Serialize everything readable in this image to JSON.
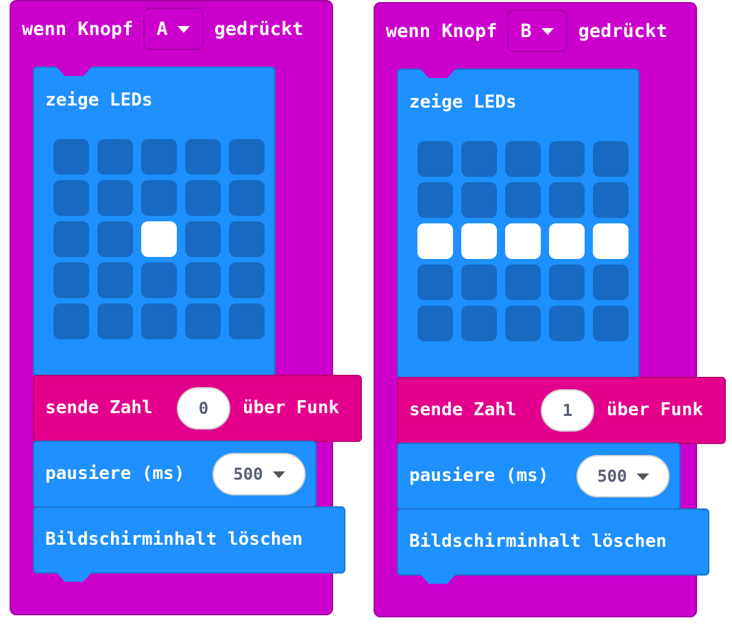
{
  "workspace": {
    "events": [
      {
        "event_prefix": "wenn Knopf",
        "button_value": "A",
        "event_suffix": "gedrückt",
        "show_leds_label": "zeige LEDs",
        "leds": [
          [
            0,
            0,
            0,
            0,
            0
          ],
          [
            0,
            0,
            0,
            0,
            0
          ],
          [
            0,
            0,
            1,
            0,
            0
          ],
          [
            0,
            0,
            0,
            0,
            0
          ],
          [
            0,
            0,
            0,
            0,
            0
          ]
        ],
        "radio_label_prefix": "sende Zahl",
        "radio_number": "0",
        "radio_label_suffix": "über Funk",
        "pause_label": "pausiere (ms)",
        "pause_value": "500",
        "clear_label": "Bildschirminhalt löschen"
      },
      {
        "event_prefix": "wenn Knopf",
        "button_value": "B",
        "event_suffix": "gedrückt",
        "show_leds_label": "zeige LEDs",
        "leds": [
          [
            0,
            0,
            0,
            0,
            0
          ],
          [
            0,
            0,
            0,
            0,
            0
          ],
          [
            1,
            1,
            1,
            1,
            1
          ],
          [
            0,
            0,
            0,
            0,
            0
          ],
          [
            0,
            0,
            0,
            0,
            0
          ]
        ],
        "radio_label_prefix": "sende Zahl",
        "radio_number": "1",
        "radio_label_suffix": "über Funk",
        "pause_label": "pausiere (ms)",
        "pause_value": "500",
        "clear_label": "Bildschirminhalt löschen"
      }
    ]
  },
  "colors": {
    "event_block": "#cc00cc",
    "basic_block": "#1e90ff",
    "radio_block": "#e3008c",
    "led_off": "#1769c2",
    "led_on": "#ffffff"
  }
}
